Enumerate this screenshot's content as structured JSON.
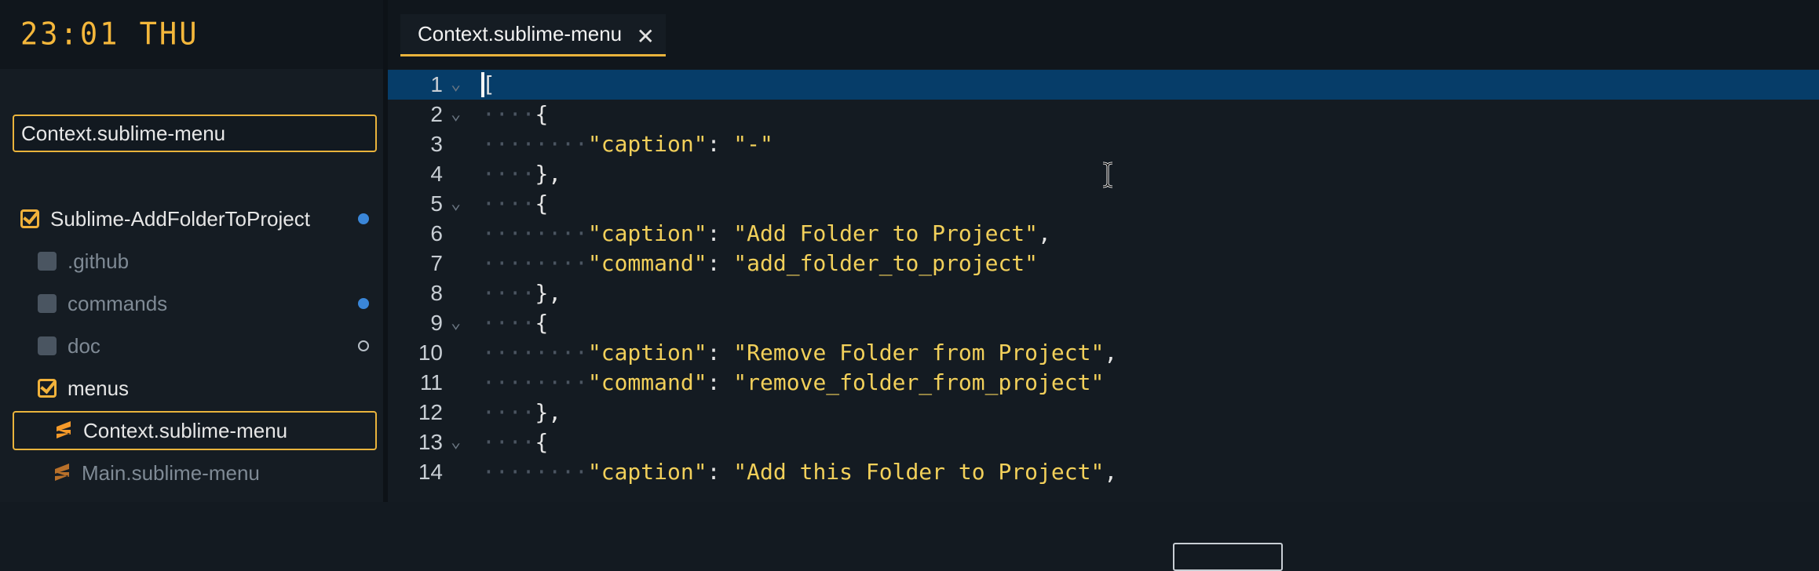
{
  "sidebar": {
    "clock": "23:01 THU",
    "filter_value": "Context.sublime-menu",
    "tree": [
      {
        "label": "Sublime-AddFolderToProject",
        "kind": "folder",
        "checked": true,
        "indent": 0,
        "dot": "filled"
      },
      {
        "label": ".github",
        "kind": "folder",
        "checked": false,
        "indent": 1,
        "dot": null
      },
      {
        "label": "commands",
        "kind": "folder",
        "checked": false,
        "indent": 1,
        "dot": "filled"
      },
      {
        "label": "doc",
        "kind": "folder",
        "checked": false,
        "indent": 1,
        "dot": "hollow"
      },
      {
        "label": "menus",
        "kind": "folder",
        "checked": true,
        "indent": 1,
        "dot": null
      },
      {
        "label": "Context.sublime-menu",
        "kind": "file",
        "indent": 2,
        "selected": true
      },
      {
        "label": "Main.sublime-menu",
        "kind": "file",
        "indent": 2,
        "selected": false
      }
    ]
  },
  "tabs": [
    {
      "label": "Context.sublime-menu",
      "close": "✕",
      "active": true
    }
  ],
  "editor": {
    "active_line": 1,
    "lines": [
      {
        "n": "1",
        "fold": true,
        "text": "["
      },
      {
        "n": "2",
        "fold": true,
        "text": "····{"
      },
      {
        "n": "3",
        "fold": false,
        "text": "········\"caption\": \"-\""
      },
      {
        "n": "4",
        "fold": false,
        "text": "····},"
      },
      {
        "n": "5",
        "fold": true,
        "text": "····{"
      },
      {
        "n": "6",
        "fold": false,
        "text": "········\"caption\": \"Add Folder to Project\","
      },
      {
        "n": "7",
        "fold": false,
        "text": "········\"command\": \"add_folder_to_project\""
      },
      {
        "n": "8",
        "fold": false,
        "text": "····},"
      },
      {
        "n": "9",
        "fold": true,
        "text": "····{"
      },
      {
        "n": "10",
        "fold": false,
        "text": "········\"caption\": \"Remove Folder from Project\","
      },
      {
        "n": "11",
        "fold": false,
        "text": "········\"command\": \"remove_folder_from_project\""
      },
      {
        "n": "12",
        "fold": false,
        "text": "····},"
      },
      {
        "n": "13",
        "fold": true,
        "text": "····{"
      },
      {
        "n": "14",
        "fold": false,
        "text": "········\"caption\": \"Add this Folder to Project\","
      }
    ]
  },
  "colors": {
    "accent": "#e9b33c",
    "active_line": "#063d69",
    "string": "#f2d05a",
    "modified_dot": "#3a86d8"
  },
  "icons": {
    "file": "sublime-file-icon",
    "folder_checked": "checkbox-checked-icon",
    "folder_unchecked": "checkbox-unchecked-icon",
    "fold": "chevron-down-icon",
    "close": "close-icon",
    "cursor": "ibeam-cursor-icon"
  }
}
